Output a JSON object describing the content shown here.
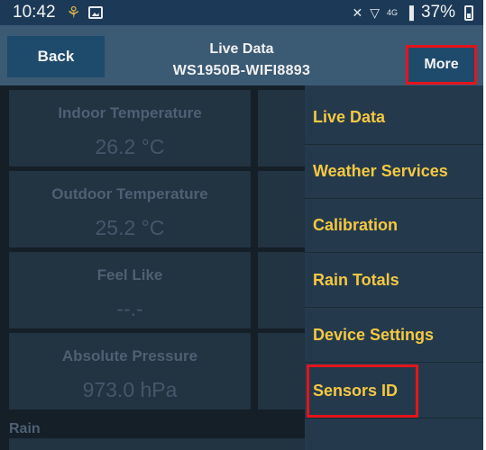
{
  "status_bar": {
    "time": "10:42",
    "battery": "37%",
    "signal_text": "4G",
    "signal_bars": "▐"
  },
  "header": {
    "back_label": "Back",
    "title": "Live Data",
    "subtitle": "WS1950B-WIFI8893",
    "more_label": "More"
  },
  "data_cells": [
    {
      "label": "Indoor Temperature",
      "value": "26.2 °C"
    },
    {
      "label": "Outdoor Temperature",
      "value": "25.2 °C"
    },
    {
      "label": "Feel Like",
      "value": "--.-"
    },
    {
      "label": "Absolute Pressure",
      "value": "973.0 hPa"
    }
  ],
  "rain_label": "Rain",
  "menu": {
    "items": [
      {
        "label": "Live Data"
      },
      {
        "label": "Weather Services"
      },
      {
        "label": "Calibration"
      },
      {
        "label": "Rain Totals"
      },
      {
        "label": "Device Settings"
      },
      {
        "label": "Sensors ID"
      }
    ]
  },
  "colors": {
    "menu_text": "#f5c842",
    "highlight": "#e3151c",
    "header_bg": "#3b5a74",
    "button_bg": "#1e4a6c"
  }
}
